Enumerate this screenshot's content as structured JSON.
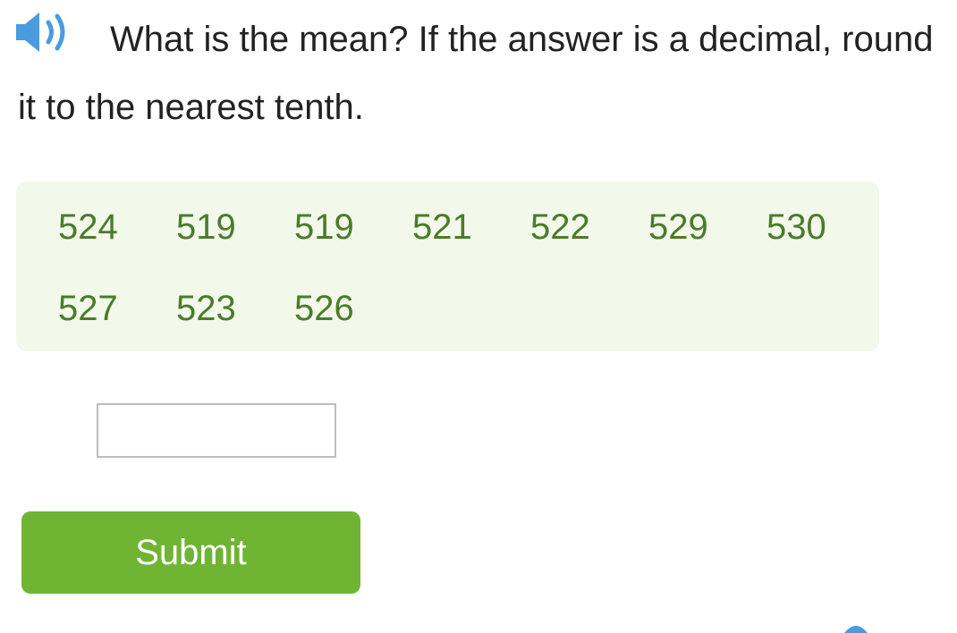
{
  "question": {
    "text": "What is the mean? If the answer is a decimal, round it to the nearest tenth."
  },
  "numbers": [
    "524",
    "519",
    "519",
    "521",
    "522",
    "529",
    "530",
    "527",
    "523",
    "526"
  ],
  "answer": {
    "value": "",
    "placeholder": ""
  },
  "submit": {
    "label": "Submit"
  },
  "colors": {
    "accent_blue": "#4a9be0",
    "number_green": "#4b7b2a",
    "box_background": "#f2f8ea",
    "button_green": "#70b434"
  },
  "icons": {
    "speaker": "speaker-icon"
  }
}
